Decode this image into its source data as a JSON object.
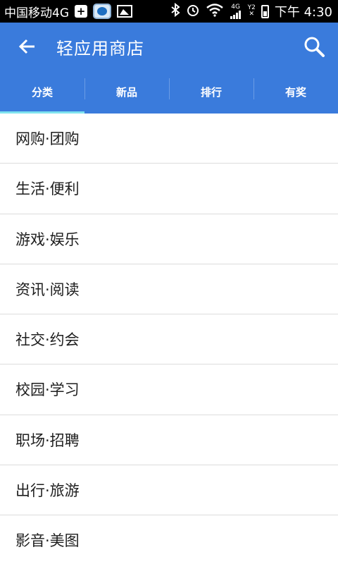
{
  "status_bar": {
    "carrier": "中国移动4G",
    "network": "4G",
    "sim": "Y2",
    "time": "下午 4:30"
  },
  "app_bar": {
    "title": "轻应用商店",
    "back_icon": "arrow-left-icon",
    "search_icon": "search-icon"
  },
  "tabs": [
    {
      "label": "分类",
      "active": true
    },
    {
      "label": "新品",
      "active": false
    },
    {
      "label": "排行",
      "active": false
    },
    {
      "label": "有奖",
      "active": false
    }
  ],
  "categories": [
    {
      "label": "网购·团购"
    },
    {
      "label": "生活·便利"
    },
    {
      "label": "游戏·娱乐"
    },
    {
      "label": "资讯·阅读"
    },
    {
      "label": "社交·约会"
    },
    {
      "label": "校园·学习"
    },
    {
      "label": "职场·招聘"
    },
    {
      "label": "出行·旅游"
    },
    {
      "label": "影音·美图"
    }
  ],
  "colors": {
    "primary": "#3a7bdc",
    "tab_indicator": "#7fe3ef",
    "divider": "#dcdcdc"
  }
}
